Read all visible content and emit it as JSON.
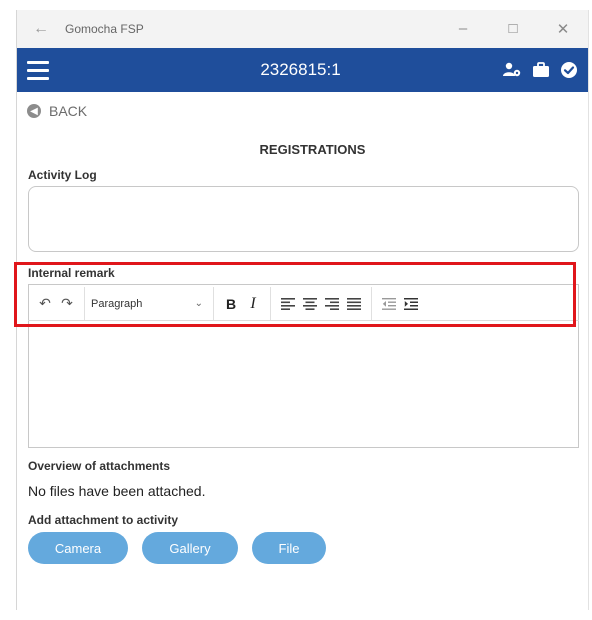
{
  "window": {
    "title": "Gomocha FSP",
    "back_icon": "arrow-left-icon",
    "controls": [
      "minimize-icon",
      "maximize-icon",
      "close-icon"
    ]
  },
  "appbar": {
    "title": "2326815:1",
    "color": "#1f4e9b",
    "icons": [
      "menu-icon",
      "user-settings-icon",
      "briefcase-icon",
      "check-circle-icon"
    ]
  },
  "nav": {
    "back_label": "BACK"
  },
  "page": {
    "title": "REGISTRATIONS"
  },
  "activity_log": {
    "label": "Activity Log",
    "value": ""
  },
  "internal_remark": {
    "label": "Internal remark",
    "value": "",
    "toolbar": {
      "format_select": "Paragraph",
      "bold": "B",
      "italic": "I",
      "buttons": [
        "undo-icon",
        "redo-icon",
        "bold-icon",
        "italic-icon",
        "align-left-icon",
        "align-center-icon",
        "align-right-icon",
        "align-justify-icon",
        "outdent-icon",
        "indent-icon"
      ]
    },
    "highlight_color": "#e0161b"
  },
  "attachments": {
    "overview_label": "Overview of attachments",
    "empty_text": "No files have been attached.",
    "add_label": "Add attachment to activity",
    "buttons": {
      "camera": "Camera",
      "gallery": "Gallery",
      "file": "File"
    },
    "button_color": "#64a9dd"
  }
}
